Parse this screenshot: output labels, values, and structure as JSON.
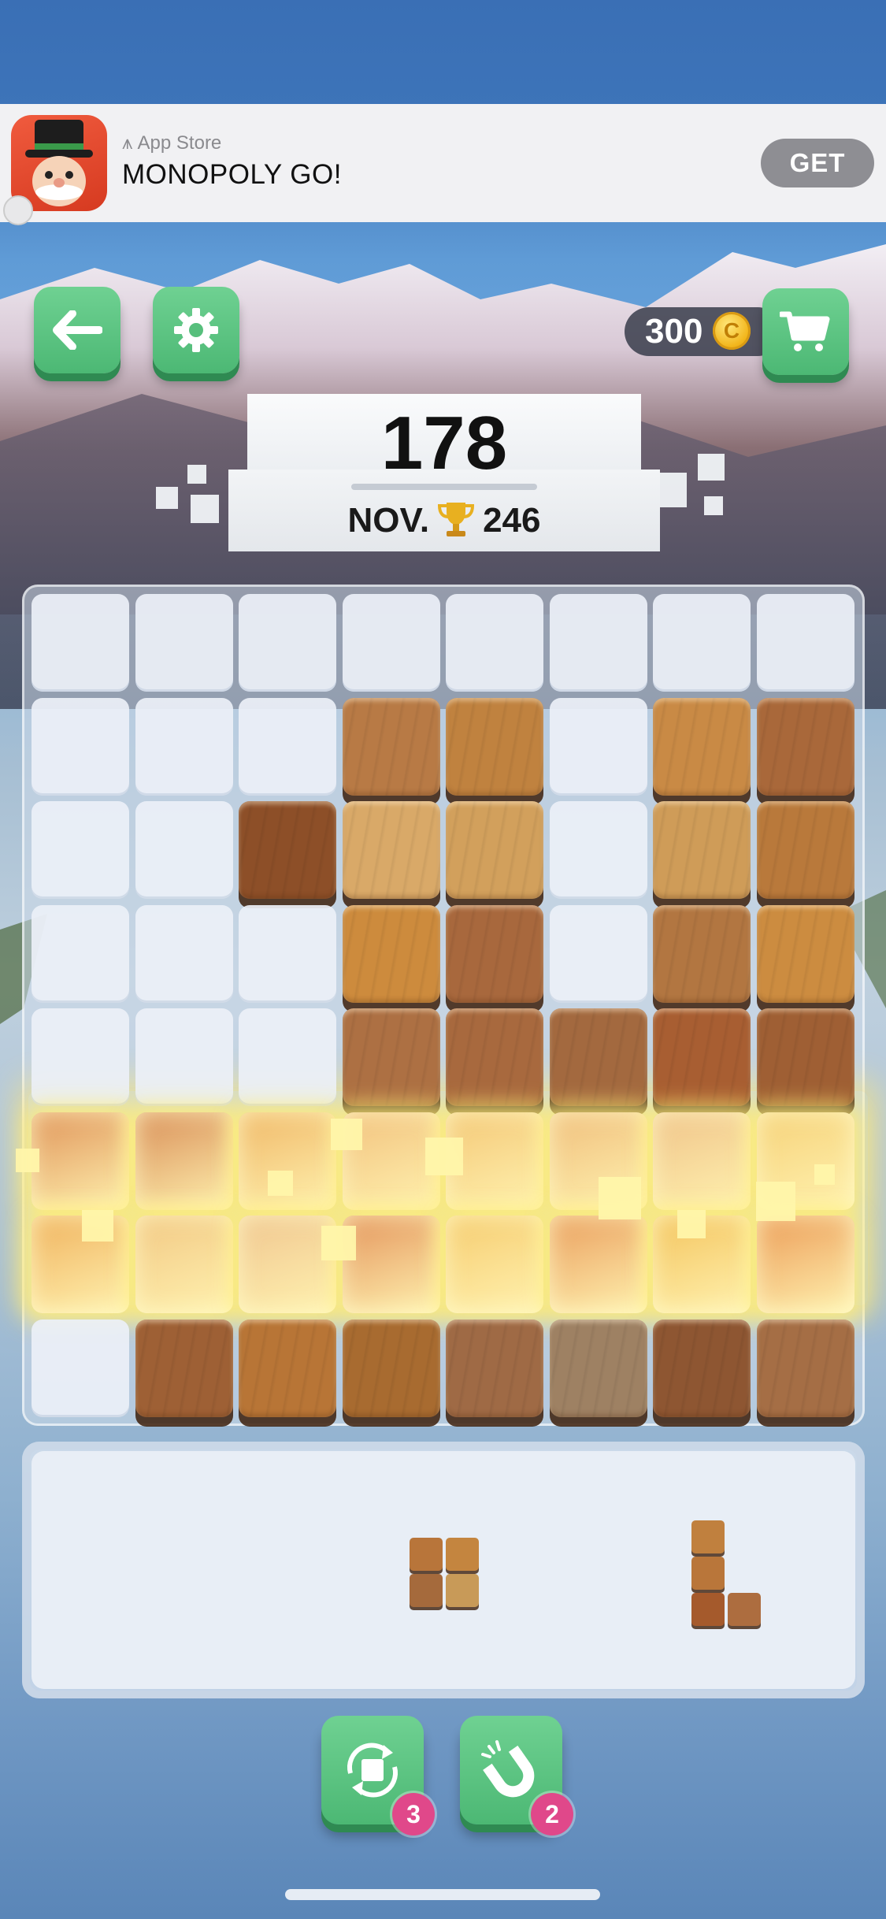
{
  "ad": {
    "store_label": "App Store",
    "title": "MONOPOLY GO!",
    "cta": "GET"
  },
  "header": {
    "back_icon": "back-arrow-icon",
    "settings_icon": "gear-icon",
    "cart_icon": "shopping-cart-icon",
    "coins": "300",
    "coin_glyph": "C"
  },
  "score": {
    "current": "178",
    "best_label": "NOV.",
    "best_icon": "trophy-icon",
    "best_value": "246"
  },
  "board": {
    "rows": 8,
    "cols": 8,
    "grid": [
      "........",
      "...AB.CD",
      "..EFG.HI",
      "...JK.LM",
      "...NOPQR",
      "SSSSSSSS",
      "SSSSSSSS",
      ".TUVWXYZ"
    ],
    "wood_colors": {
      "A": "#b87a45",
      "B": "#c0823f",
      "C": "#c98a45",
      "D": "#a9683a",
      "E": "#8d4f28",
      "F": "#d9a968",
      "G": "#d2a05c",
      "H": "#cf9c58",
      "I": "#b9793b",
      "J": "#cd8b3d",
      "K": "#a8683d",
      "L": "#b27641",
      "M": "#cc8c40",
      "N": "#ad7043",
      "O": "#a8693e",
      "P": "#a3693f",
      "Q": "#a85e32",
      "R": "#9f5f34",
      "T": "#9e6035",
      "U": "#b87536",
      "V": "#a86b30",
      "W": "#9f6a45",
      "X": "#9e8163",
      "Y": "#8e5632",
      "Z": "#a56e45"
    },
    "clearing_rows_colors": [
      [
        "#e0945a",
        "#d98e58",
        "#f0b868",
        "#f2c27e",
        "#f4c877",
        "#f0bf7d",
        "#f0c48a",
        "#f6d27a"
      ],
      [
        "#f0b25e",
        "#f2c884",
        "#f0c690",
        "#e4945c",
        "#f6cc70",
        "#ea9e5e",
        "#f4c45e",
        "#ec9c58"
      ]
    ]
  },
  "tray": {
    "pieces": [
      {
        "name": "square-2x2",
        "colors": [
          "#b8753a",
          "#c4853f",
          "#a56a3c",
          "#c89a58"
        ]
      },
      {
        "name": "l-shape",
        "colors": [
          "#c0803e",
          "#b9763a",
          "#a55a2c",
          "#ad6d3f"
        ]
      }
    ]
  },
  "powerups": [
    {
      "name": "rotate",
      "icon": "rotate-icon",
      "count": "3"
    },
    {
      "name": "magnet",
      "icon": "magnet-icon",
      "count": "2"
    }
  ]
}
